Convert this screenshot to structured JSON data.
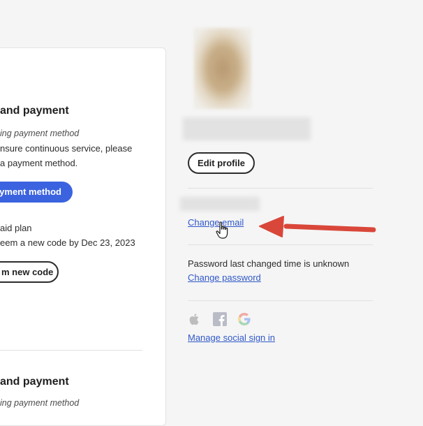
{
  "left_panel": {
    "section1": {
      "title": "and payment",
      "note": "ing payment method",
      "desc_line1": "nsure continuous service, please",
      "desc_line2": "a payment method.",
      "add_button": "yment method",
      "plan_label": "aid plan",
      "redeem_text": "eem a new code by Dec 23, 2023",
      "redeem_button": "m new code"
    },
    "section2": {
      "title": "and payment",
      "note": "ing payment method"
    }
  },
  "profile": {
    "edit_profile_label": "Edit profile",
    "change_email_label": "Change email",
    "password_status": "Password last changed time is unknown",
    "change_password_label": "Change password",
    "manage_social_label": "Manage social sign in",
    "social_icons": [
      "apple-icon",
      "facebook-icon",
      "google-icon"
    ]
  },
  "colors": {
    "accent_blue": "#3b63e0",
    "link_blue": "#2f58c9",
    "arrow_red": "#d9473a"
  }
}
